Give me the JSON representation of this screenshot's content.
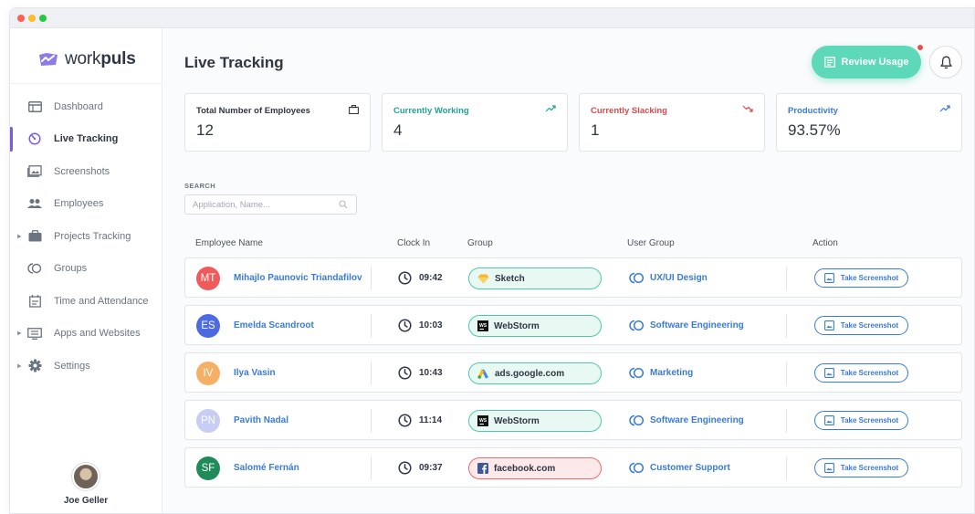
{
  "app": {
    "logo_text_light": "work",
    "logo_text_bold": "puls"
  },
  "sidebar": {
    "items": [
      {
        "label": "Dashboard",
        "icon": "dashboard-icon"
      },
      {
        "label": "Live Tracking",
        "icon": "live-tracking-icon",
        "active": true
      },
      {
        "label": "Screenshots",
        "icon": "screenshots-icon"
      },
      {
        "label": "Employees",
        "icon": "employees-icon"
      },
      {
        "label": "Projects Tracking",
        "icon": "briefcase-icon",
        "expandable": true
      },
      {
        "label": "Groups",
        "icon": "groups-icon"
      },
      {
        "label": "Time and Attendance",
        "icon": "calendar-icon"
      },
      {
        "label": "Apps and Websites",
        "icon": "apps-icon",
        "expandable": true
      },
      {
        "label": "Settings",
        "icon": "gear-icon",
        "expandable": true
      }
    ],
    "user_name": "Joe Geller"
  },
  "header": {
    "title": "Live Tracking",
    "review_label": "Review Usage"
  },
  "stats": [
    {
      "label": "Total Number of Employees",
      "value": "12",
      "color": "#2f3542",
      "icon": "briefcase-icon"
    },
    {
      "label": "Currently Working",
      "value": "4",
      "color": "#1fa39a",
      "icon": "trend-up-icon"
    },
    {
      "label": "Currently Slacking",
      "value": "1",
      "color": "#e0474c",
      "icon": "trend-down-icon"
    },
    {
      "label": "Productivity",
      "value": "93.57%",
      "color": "#3a7bd5",
      "icon": "trend-up-icon"
    }
  ],
  "search": {
    "label": "SEARCH",
    "placeholder": "Application, Name..."
  },
  "table": {
    "headers": {
      "employee": "Employee Name",
      "clock": "Clock In",
      "group": "Group",
      "user_group": "User Group",
      "action": "Action"
    },
    "rows": [
      {
        "initials": "MT",
        "avatar_color": "#ef5b5b",
        "name": "Mihajlo Paunovic Triandafilov",
        "clock_in": "09:42",
        "group": "Sketch",
        "group_icon": "sketch-icon",
        "group_style": "green",
        "user_group": "UX/UI Design",
        "action": "Take Screenshot"
      },
      {
        "initials": "ES",
        "avatar_color": "#4d6be0",
        "name": "Emelda Scandroot",
        "clock_in": "10:03",
        "group": "WebStorm",
        "group_icon": "webstorm-icon",
        "group_style": "green",
        "user_group": "Software Engineering",
        "action": "Take Screenshot"
      },
      {
        "initials": "IV",
        "avatar_color": "#f5b066",
        "name": "Ilya Vasin",
        "clock_in": "10:43",
        "group": "ads.google.com",
        "group_icon": "google-ads-icon",
        "group_style": "green",
        "user_group": "Marketing",
        "action": "Take Screenshot"
      },
      {
        "initials": "PN",
        "avatar_color": "#c7cdf4",
        "name": "Pavith Nadal",
        "clock_in": "11:14",
        "group": "WebStorm",
        "group_icon": "webstorm-icon",
        "group_style": "green",
        "user_group": "Software Engineering",
        "action": "Take Screenshot"
      },
      {
        "initials": "SF",
        "avatar_color": "#1f8a5a",
        "name": "Salomé Fernán",
        "clock_in": "09:37",
        "group": "facebook.com",
        "group_icon": "facebook-icon",
        "group_style": "red",
        "user_group": "Customer Support",
        "action": "Take Screenshot"
      }
    ]
  }
}
